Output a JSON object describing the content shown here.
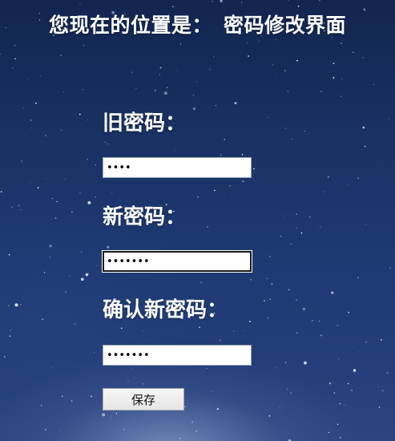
{
  "header": {
    "location_prefix": "您现在的位置是：",
    "location_page": "密码修改界面"
  },
  "form": {
    "old_password": {
      "label": "旧密码：",
      "value": "1234"
    },
    "new_password": {
      "label": "新密码：",
      "value": "1234567"
    },
    "confirm_password": {
      "label": "确认新密码：",
      "value": "1234567"
    },
    "save_label": "保存"
  },
  "colors": {
    "background": "#1d3a74",
    "text": "#ffffff"
  }
}
